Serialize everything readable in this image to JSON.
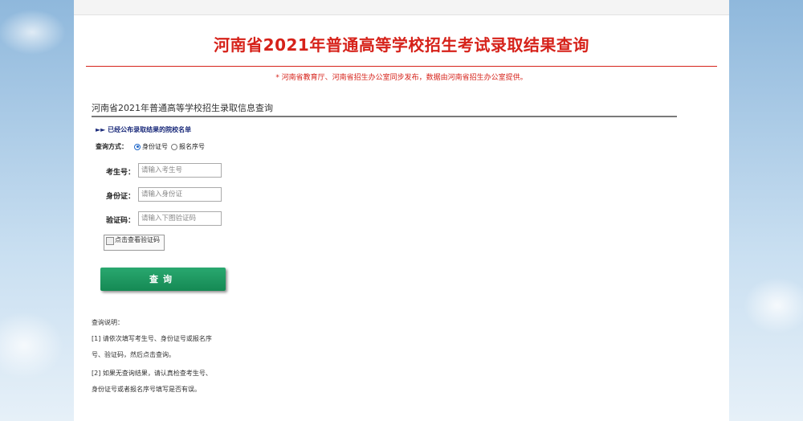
{
  "header": {
    "title": "河南省2021年普通高等学校招生考试录取结果查询",
    "notice": "* 河南省教育厅、河南省招生办公室同步发布，数据由河南省招生办公室提供。"
  },
  "section": {
    "title": "河南省2021年普通高等学校招生录取信息查询",
    "school_list_link": "►► 已经公布录取结果的院校名单"
  },
  "query_mode": {
    "label": "查询方式：",
    "options": [
      "身份证号",
      "报名序号"
    ],
    "selected": "身份证号"
  },
  "form": {
    "exam_no": {
      "label": "考生号：",
      "placeholder": "请输入考生号"
    },
    "id_no": {
      "label": "身份证：",
      "placeholder": "请输入身份证"
    },
    "captcha": {
      "label": "验证码：",
      "placeholder": "请输入下图验证码"
    },
    "captcha_image_alt": "点击查看验证码"
  },
  "submit_label": "查询",
  "help": {
    "title": "查询说明：",
    "lines": [
      "[1] 请依次填写考生号、身份证号或报名序",
      "号、验证码，然后点击查询。",
      "[2] 如果无查询结果，请认真检查考生号、",
      "身份证号或者报名序号填写是否有误。"
    ]
  },
  "colors": {
    "title_red": "#d6221a",
    "button_green": "#1e9a60",
    "link_blue": "#1a2a7a"
  }
}
